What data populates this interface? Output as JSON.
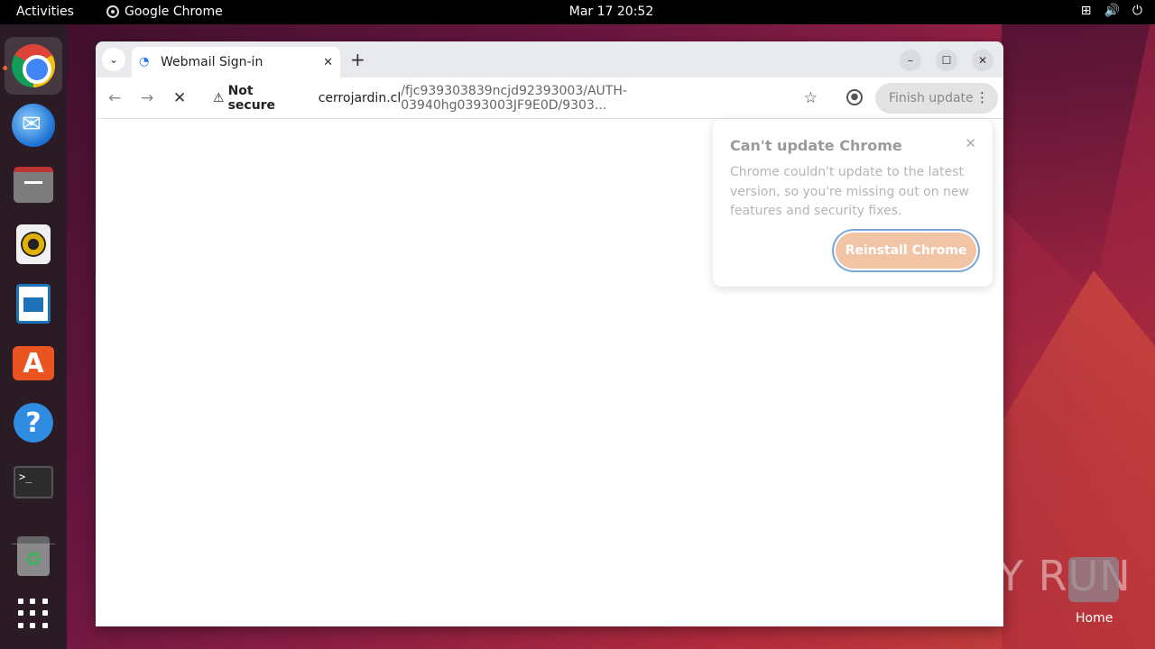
{
  "topbar": {
    "activities": "Activities",
    "app_name": "Google Chrome",
    "clock": "Mar 17  20:52"
  },
  "dock": {
    "items": [
      "google-chrome",
      "thunderbird",
      "files",
      "rhythmbox",
      "libreoffice-writer",
      "app-center",
      "help",
      "terminal",
      "trash",
      "show-apps"
    ]
  },
  "browser": {
    "tab_title": "Webmail Sign-in",
    "security_label": "Not secure",
    "url_host": "cerrojardin.cl",
    "url_path": "/fjc939303839ncjd92393003/AUTH-03940hg0393003JF9E0D/9303...",
    "finish_update_label": "Finish update"
  },
  "popup": {
    "title": "Can't update Chrome",
    "body": "Chrome couldn't update to the latest version, so you're missing out on new features and security fixes.",
    "button": "Reinstall Chrome"
  },
  "desktop": {
    "watermark": "ANY RUN",
    "home_label": "Home"
  },
  "colors": {
    "accent_orange": "#e95420",
    "button_peach": "#f2c4a6"
  }
}
